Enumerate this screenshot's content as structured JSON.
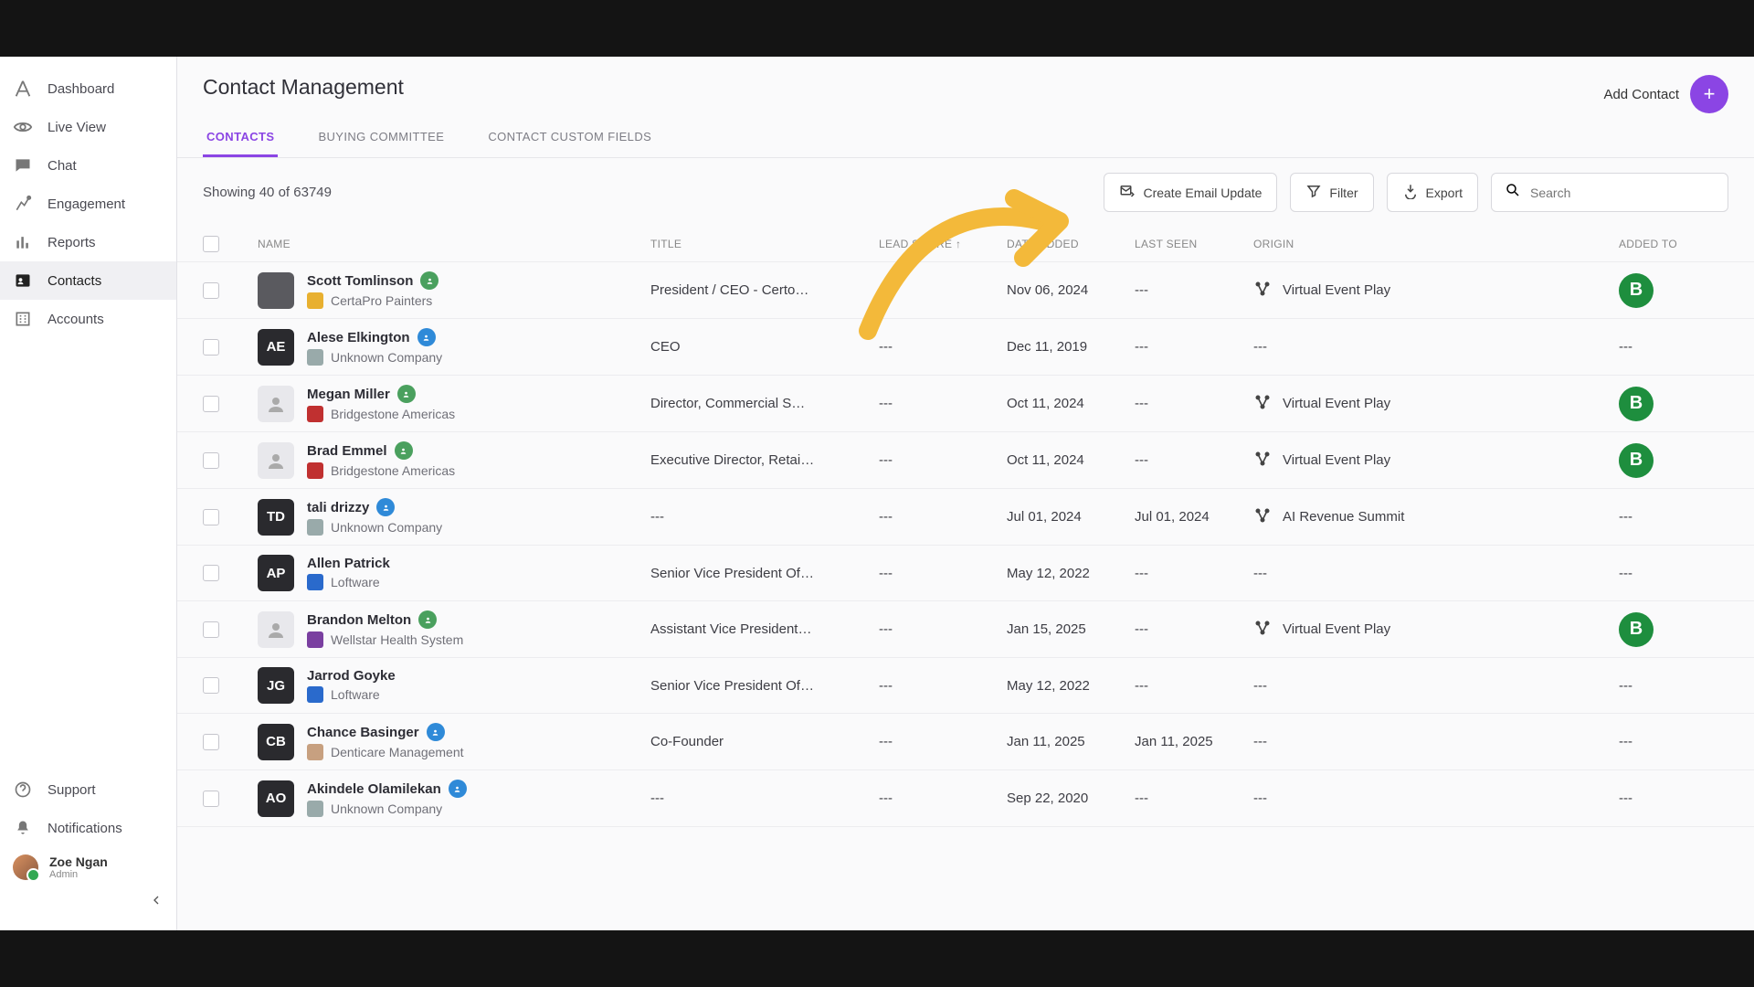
{
  "sidebar": {
    "items": [
      {
        "label": "Dashboard"
      },
      {
        "label": "Live View"
      },
      {
        "label": "Chat"
      },
      {
        "label": "Engagement"
      },
      {
        "label": "Reports"
      },
      {
        "label": "Contacts"
      },
      {
        "label": "Accounts"
      }
    ],
    "bottom": [
      {
        "label": "Support"
      },
      {
        "label": "Notifications"
      }
    ],
    "user": {
      "name": "Zoe Ngan",
      "role": "Admin"
    }
  },
  "header": {
    "title": "Contact Management",
    "add_contact": "Add Contact",
    "tabs": [
      {
        "label": "CONTACTS",
        "active": true
      },
      {
        "label": "BUYING COMMITTEE"
      },
      {
        "label": "CONTACT CUSTOM FIELDS"
      }
    ]
  },
  "toolbar": {
    "showing_prefix": "Showing ",
    "shown": "40",
    "of": " of  ",
    "total": "63749",
    "create_email": "Create Email Update",
    "filter": "Filter",
    "export": "Export",
    "search_placeholder": "Search"
  },
  "columns": {
    "name": "NAME",
    "title": "TITLE",
    "lead_score": "LEAD SCORE ↑",
    "date_added": "DATE ADDED",
    "last_seen": "LAST SEEN",
    "origin": "ORIGIN",
    "added_to": "ADDED TO"
  },
  "rows": [
    {
      "avatar": "photo",
      "initials": "",
      "name": "Scott Tomlinson",
      "type": "green",
      "company": "CertaPro Painters",
      "clogo": "#e8b030",
      "ctext": "",
      "title": "President / CEO - Certo…",
      "lead": "---",
      "date": "Nov 06, 2024",
      "last": "---",
      "origin": "Virtual Event Play",
      "origin_icon": true,
      "added": "B"
    },
    {
      "avatar": "initials",
      "initials": "AE",
      "name": "Alese Elkington",
      "type": "blue",
      "company": "Unknown Company",
      "clogo": "#9aa",
      "title": "CEO",
      "lead": "---",
      "date": "Dec 11, 2019",
      "last": "---",
      "origin": "---",
      "origin_icon": false,
      "added": "---"
    },
    {
      "avatar": "silhouette",
      "initials": "",
      "name": "Megan Miller",
      "type": "green",
      "company": "Bridgestone Americas",
      "clogo": "#c03030",
      "title": "Director, Commercial S…",
      "lead": "---",
      "date": "Oct 11, 2024",
      "last": "---",
      "origin": "Virtual Event Play",
      "origin_icon": true,
      "added": "B"
    },
    {
      "avatar": "silhouette",
      "initials": "",
      "name": "Brad Emmel",
      "type": "green",
      "company": "Bridgestone Americas",
      "clogo": "#c03030",
      "title": "Executive Director, Retai…",
      "lead": "---",
      "date": "Oct 11, 2024",
      "last": "---",
      "origin": "Virtual Event Play",
      "origin_icon": true,
      "added": "B"
    },
    {
      "avatar": "initials",
      "initials": "TD",
      "name": "tali drizzy",
      "type": "blue",
      "company": "Unknown Company",
      "clogo": "#9aa",
      "title": "---",
      "lead": "---",
      "date": "Jul 01, 2024",
      "last": "Jul 01, 2024",
      "origin": "AI Revenue Summit",
      "origin_icon": true,
      "added": "---"
    },
    {
      "avatar": "initials",
      "initials": "AP",
      "name": "Allen Patrick",
      "type": "",
      "company": "Loftware",
      "clogo": "#2a6acc",
      "title": "Senior Vice President Of…",
      "lead": "---",
      "date": "May 12, 2022",
      "last": "---",
      "origin": "---",
      "origin_icon": false,
      "added": "---"
    },
    {
      "avatar": "silhouette",
      "initials": "",
      "name": "Brandon Melton",
      "type": "green",
      "company": "Wellstar Health System",
      "clogo": "#7a3fa0",
      "title": "Assistant Vice President…",
      "lead": "---",
      "date": "Jan 15, 2025",
      "last": "---",
      "origin": "Virtual Event Play",
      "origin_icon": true,
      "added": "B"
    },
    {
      "avatar": "initials",
      "initials": "JG",
      "name": "Jarrod Goyke",
      "type": "",
      "company": "Loftware",
      "clogo": "#2a6acc",
      "title": "Senior Vice President Of…",
      "lead": "---",
      "date": "May 12, 2022",
      "last": "---",
      "origin": "---",
      "origin_icon": false,
      "added": "---"
    },
    {
      "avatar": "initials",
      "initials": "CB",
      "name": "Chance Basinger",
      "type": "blue",
      "company": "Denticare Management",
      "clogo": "#c7a080",
      "title": "Co-Founder",
      "lead": "---",
      "date": "Jan 11, 2025",
      "last": "Jan 11, 2025",
      "origin": "---",
      "origin_icon": false,
      "added": "---"
    },
    {
      "avatar": "initials",
      "initials": "AO",
      "name": "Akindele Olamilekan",
      "type": "blue",
      "company": "Unknown Company",
      "clogo": "#9aa",
      "title": "---",
      "lead": "---",
      "date": "Sep 22, 2020",
      "last": "---",
      "origin": "---",
      "origin_icon": false,
      "added": "---"
    }
  ]
}
